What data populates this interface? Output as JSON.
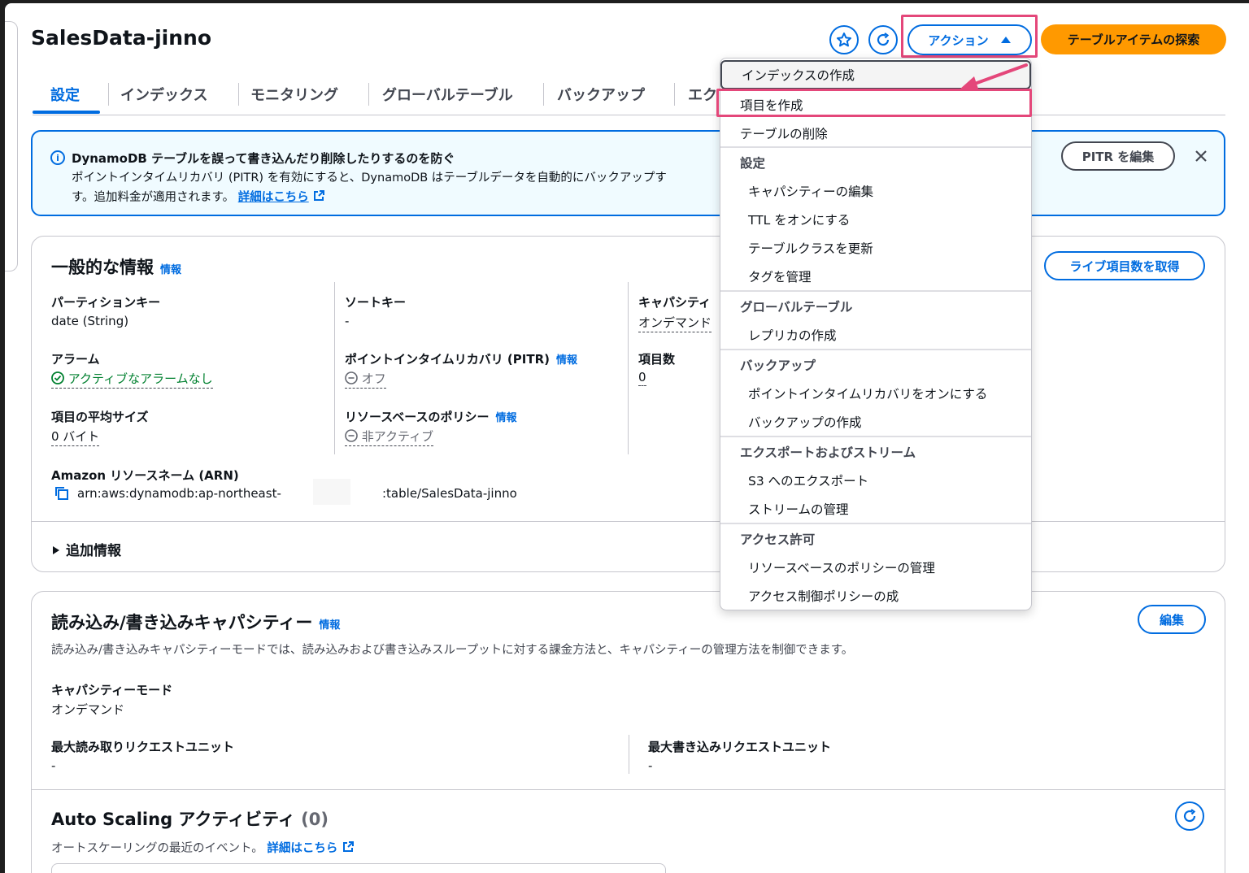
{
  "page": {
    "title": "SalesData-jinno",
    "actions_label": "アクション",
    "explore_label": "テーブルアイテムの探索"
  },
  "tabs": [
    "設定",
    "インデックス",
    "モニタリング",
    "グローバルテーブル",
    "バックアップ",
    "エク"
  ],
  "alert": {
    "title": "DynamoDB テーブルを誤って書き込んだり削除したりするのを防ぐ",
    "body_line1": "ポイントインタイムリカバリ (PITR) を有効にすると、DynamoDB はテーブルデータを自動的にバックアップす",
    "body_line2": "す。追加料金が適用されます。",
    "link": "詳細はこちら",
    "edit_button": "PITR を編集"
  },
  "general": {
    "title": "一般的な情報",
    "info": "情報",
    "live_count_button": "ライブ項目数を取得",
    "partition_key_label": "パーティションキー",
    "partition_key_value": "date (String)",
    "sort_key_label": "ソートキー",
    "sort_key_value": "-",
    "capacity_label": "キャパシティ",
    "capacity_value": "オンデマンド",
    "alarm_label": "アラーム",
    "alarm_value": "アクティブなアラームなし",
    "pitr_label": "ポイントインタイムリカバリ (PITR)",
    "pitr_info": "情報",
    "pitr_value": "オフ",
    "item_count_label": "項目数",
    "item_count_value": "0",
    "avg_size_label": "項目の平均サイズ",
    "avg_size_value": "0 バイト",
    "policy_label": "リソースベースのポリシー",
    "policy_info": "情報",
    "policy_value": "非アクティブ",
    "arn_label": "Amazon リソースネーム (ARN)",
    "arn_part1": "arn:aws:dynamodb:ap-northeast-",
    "arn_part2": ":table/SalesData-jinno",
    "additional_info": "追加情報"
  },
  "capacity": {
    "title": "読み込み/書き込みキャパシティー",
    "info": "情報",
    "edit_button": "編集",
    "description": "読み込み/書き込みキャパシティーモードでは、読み込みおよび書き込みスループットに対する課金方法と、キャパシティーの管理方法を制御できます。",
    "mode_label": "キャパシティーモード",
    "mode_value": "オンデマンド",
    "max_read_label": "最大読み取りリクエストユニット",
    "max_read_value": "-",
    "max_write_label": "最大書き込みリクエストユニット",
    "max_write_value": "-"
  },
  "autoscaling": {
    "title": "Auto Scaling アクティビティ",
    "count": "(0)",
    "description": "オートスケーリングの最近のイベント。",
    "link": "詳細はこちら"
  },
  "menu": {
    "create_index": "インデックスの作成",
    "create_item": "項目を作成",
    "delete_table": "テーブルの削除",
    "settings_header": "設定",
    "edit_capacity": "キャパシティーの編集",
    "enable_ttl": "TTL をオンにする",
    "update_class": "テーブルクラスを更新",
    "manage_tags": "タグを管理",
    "global_header": "グローバルテーブル",
    "create_replica": "レプリカの作成",
    "backup_header": "バックアップ",
    "enable_pitr": "ポイントインタイムリカバリをオンにする",
    "create_backup": "バックアップの作成",
    "export_header": "エクスポートおよびストリーム",
    "export_s3": "S3 へのエクスポート",
    "manage_stream": "ストリームの管理",
    "access_header": "アクセス許可",
    "manage_policy": "リソースベースのポリシーの管理",
    "access_policy": "アクセス制御ポリシーの成"
  },
  "colors": {
    "accent": "#006ce0",
    "primary_button": "#ff9900",
    "highlight": "#e4477a",
    "success": "#00802f"
  }
}
